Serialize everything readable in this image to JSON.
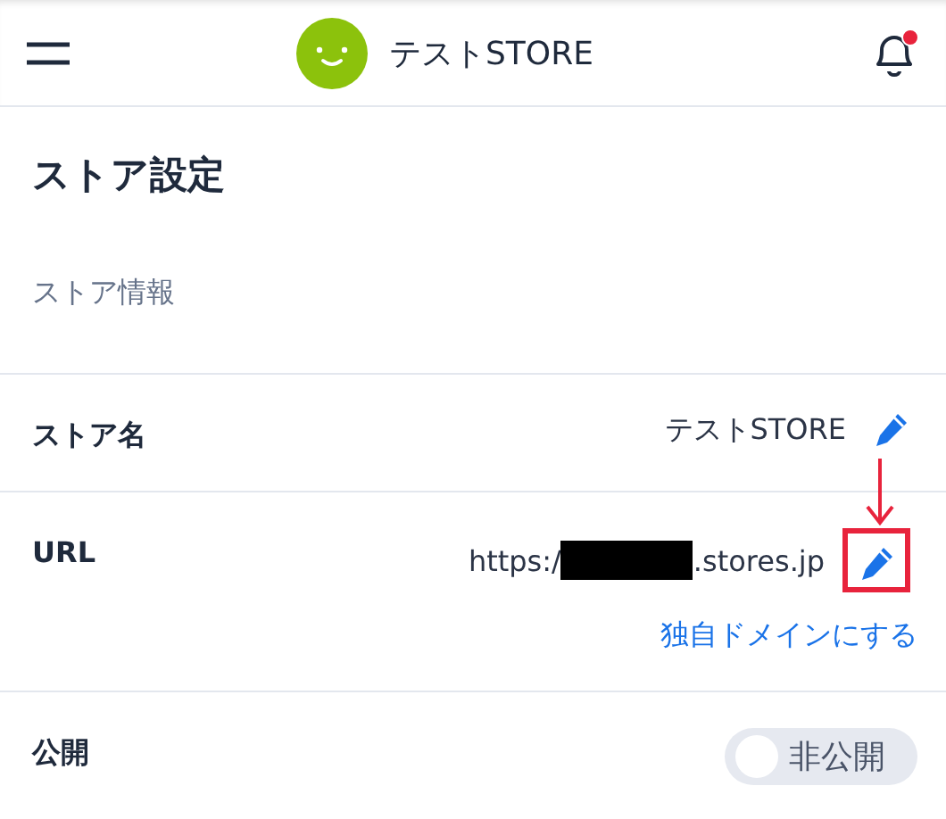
{
  "header": {
    "store_name": "テストSTORE",
    "notification_unread": true
  },
  "page_title": "ストア設定",
  "section_title": "ストア情報",
  "rows": [
    {
      "kind": "text",
      "label": "ストア名",
      "value": "テストSTORE"
    },
    {
      "kind": "url",
      "label": "URL",
      "value_prefix": "https:/",
      "value_suffix": ".stores.jp",
      "link": "独自ドメインにする",
      "highlighted": true
    },
    {
      "kind": "toggle",
      "label": "公開",
      "toggle_label": "非公開",
      "on": false
    }
  ]
}
